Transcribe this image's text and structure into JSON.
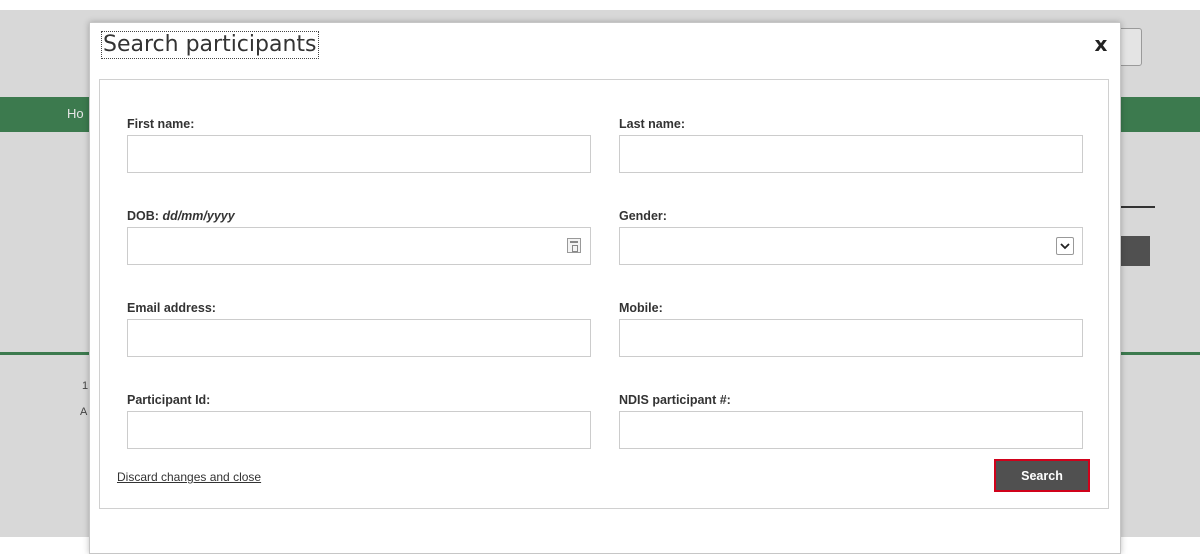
{
  "background": {
    "nav_text": "Ho",
    "text_line1": "1",
    "text_line2": "A"
  },
  "modal": {
    "title": "Search participants",
    "close_glyph": "x",
    "fields": {
      "first_name": {
        "label": "First name:",
        "value": "",
        "placeholder": ""
      },
      "last_name": {
        "label": "Last name:",
        "value": "",
        "placeholder": ""
      },
      "dob": {
        "label": "DOB:",
        "hint": "dd/mm/yyyy",
        "value": ""
      },
      "gender": {
        "label": "Gender:",
        "selected": ""
      },
      "email": {
        "label": "Email address:",
        "value": ""
      },
      "mobile": {
        "label": "Mobile:",
        "value": ""
      },
      "participant_id": {
        "label": "Participant Id:",
        "value": ""
      },
      "ndis": {
        "label": "NDIS participant #:",
        "value": ""
      }
    },
    "discard_label": "Discard changes and close",
    "search_label": "Search"
  },
  "colors": {
    "nav_green": "#3c7a4e",
    "button_dark": "#505050",
    "highlight_red": "#d0021b"
  },
  "icons": [
    "close-icon",
    "calendar-icon",
    "chevron-down-icon"
  ]
}
